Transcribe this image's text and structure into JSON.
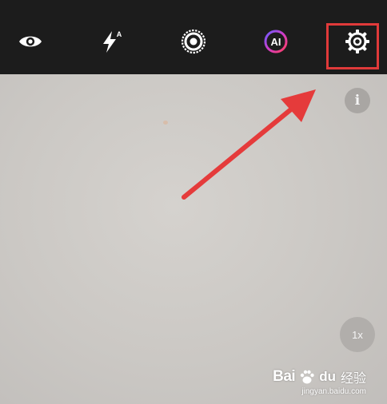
{
  "toolbar": {
    "eye": {
      "icon": "eye-icon"
    },
    "flash": {
      "icon": "flash-auto-icon",
      "mode_label": "A"
    },
    "shutter": {
      "icon": "live-photo-icon"
    },
    "ai": {
      "icon": "ai-icon",
      "label": "AI"
    },
    "settings": {
      "icon": "gear-icon"
    }
  },
  "viewfinder": {
    "info_label": "i",
    "zoom_label": "1x"
  },
  "watermark": {
    "brand_bai": "Bai",
    "brand_du": "du",
    "brand_jingyan": "经验",
    "url": "jingyan.baidu.com"
  },
  "annotation": {
    "color": "#e53b3b"
  }
}
